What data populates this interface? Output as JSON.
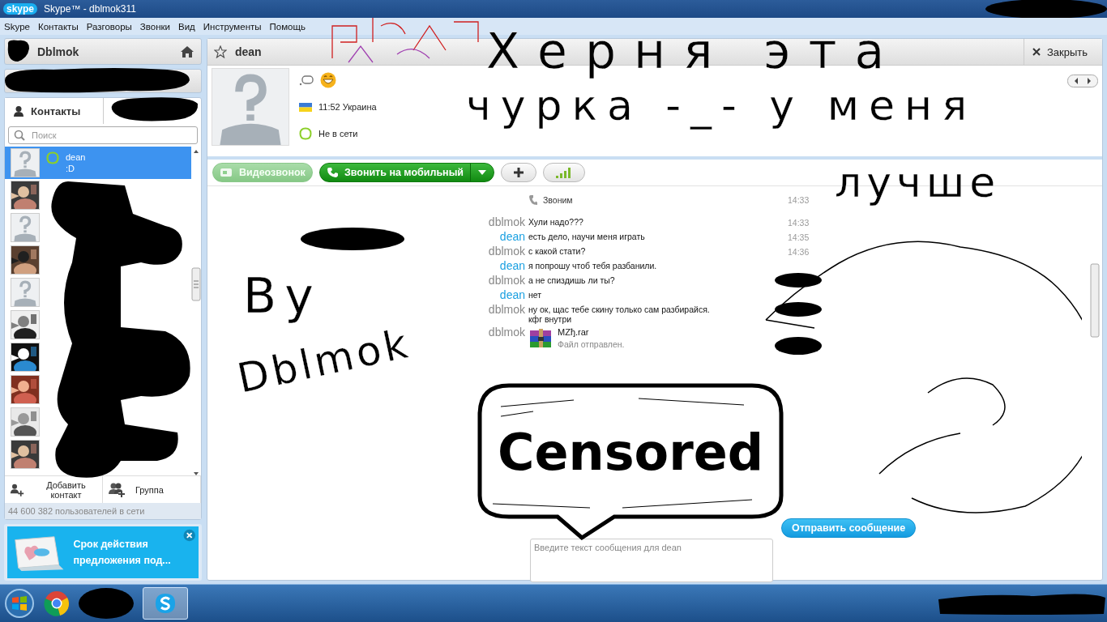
{
  "window": {
    "logo": "skype",
    "title": "Skype™ - dblmok311"
  },
  "menu": [
    "Skype",
    "Контакты",
    "Разговоры",
    "Звонки",
    "Вид",
    "Инструменты",
    "Помощь"
  ],
  "account": {
    "name": "Dblmok"
  },
  "contact_tabs": [
    {
      "label": "Контакты",
      "selected": true
    }
  ],
  "search": {
    "placeholder": "Поиск"
  },
  "contacts": [
    {
      "name": "dean",
      "mood": ":D",
      "kind": "default",
      "selected": true
    },
    {
      "kind": "picture",
      "selected": false
    },
    {
      "kind": "default",
      "selected": false
    },
    {
      "kind": "picture",
      "selected": false
    },
    {
      "kind": "default",
      "selected": false
    },
    {
      "kind": "picture",
      "selected": false
    },
    {
      "kind": "picture",
      "selected": false
    },
    {
      "kind": "picture",
      "selected": false
    },
    {
      "kind": "picture",
      "selected": false
    },
    {
      "kind": "picture",
      "selected": false
    }
  ],
  "contact_actions": [
    {
      "label": "Добавить контакт",
      "kind": "add"
    },
    {
      "label": "Группа",
      "kind": "group"
    }
  ],
  "online_count": "44 600 382 пользователей в сети",
  "promo": {
    "text": "Срок действия предложения под..."
  },
  "conversation": {
    "name": "dean",
    "close_label": "Закрыть",
    "local_time": "11:52 Украина",
    "status": "Не в сети",
    "buttons": [
      {
        "kind": "video",
        "label": "Видеозвонок",
        "disabled": true
      },
      {
        "kind": "call",
        "label": "Звонить на мобильный",
        "disabled": false
      },
      {
        "kind": "add",
        "disabled": false
      },
      {
        "kind": "quality",
        "disabled": false
      }
    ]
  },
  "messages": [
    {
      "kind": "call",
      "text": "Звоним",
      "time": "14:33"
    },
    {
      "kind": "message",
      "sender": "dblmok",
      "self": true,
      "text": "Хули надо???",
      "time": "14:33"
    },
    {
      "kind": "message",
      "sender": "dean",
      "self": false,
      "text": "есть дело, научи меня играть",
      "time": "14:35"
    },
    {
      "kind": "message",
      "sender": "dblmok",
      "self": true,
      "text": "с какой стати?",
      "time": "14:36"
    },
    {
      "kind": "message",
      "sender": "dean",
      "self": false,
      "text": "я попрошу чтоб тебя разбанили."
    },
    {
      "kind": "message",
      "sender": "dblmok",
      "self": true,
      "text": "а не спиздишь ли ты?"
    },
    {
      "kind": "message",
      "sender": "dean",
      "self": false,
      "text": "нет"
    },
    {
      "kind": "message",
      "sender": "dblmok",
      "self": true,
      "text": "ну ок, щас тебе скину только сам разбирайся.\nкфг внутри"
    },
    {
      "kind": "file",
      "sender": "dblmok",
      "self": true,
      "file": "MZђ.rar",
      "note": "Файл отправлен."
    }
  ],
  "composer": {
    "placeholder": "Введите текст сообщения для dean",
    "send_label": "Отправить сообщение"
  },
  "annotations": [
    {
      "text": "Херня эта"
    },
    {
      "text": "чурка -_- у меня"
    },
    {
      "text": "лучше"
    },
    {
      "text": "By"
    },
    {
      "text": "Dblmok"
    }
  ],
  "censor_label": "Censored"
}
